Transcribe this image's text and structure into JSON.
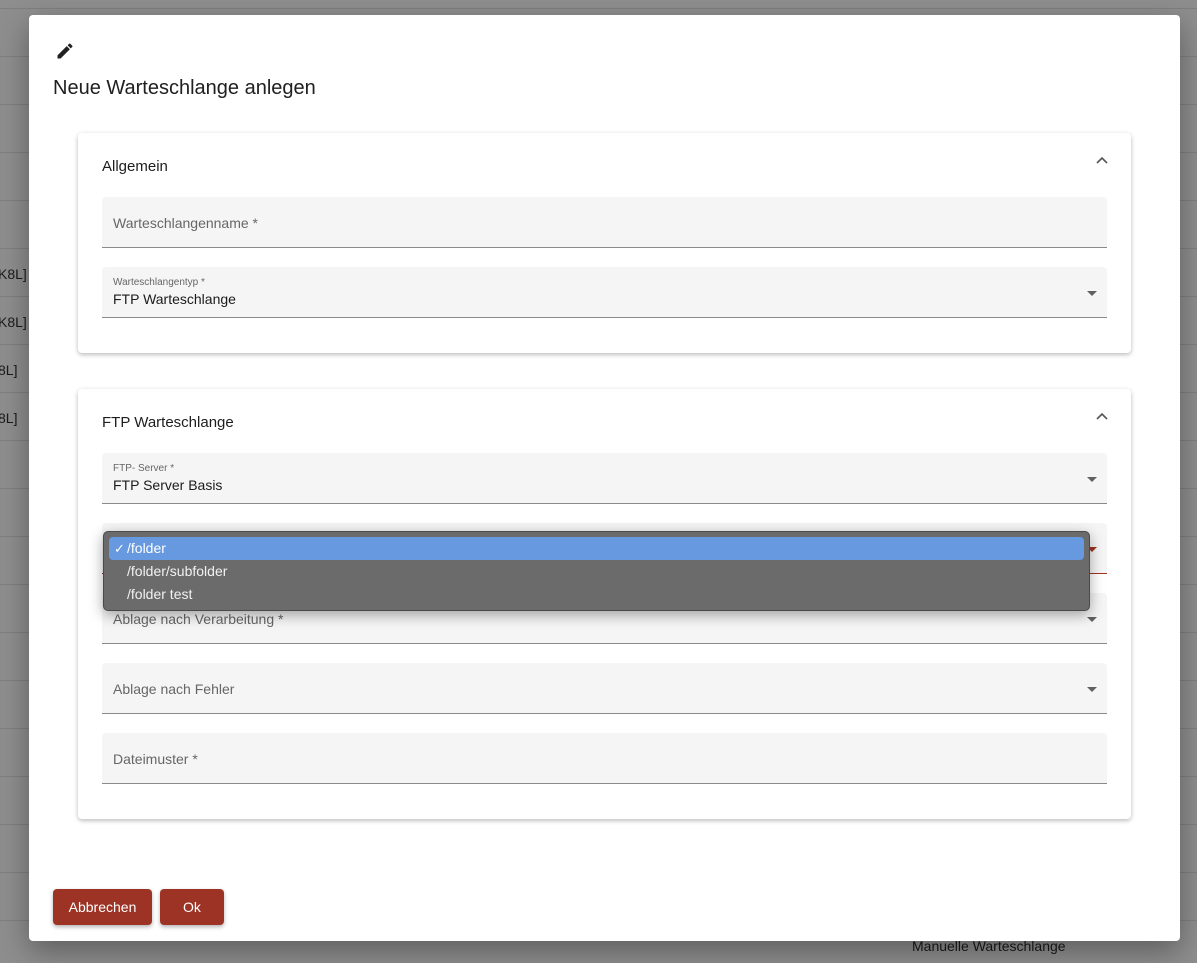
{
  "background": {
    "row_texts": [
      "K8L]",
      "K8L]",
      "8L]",
      "8L]"
    ],
    "footer_text": "Manuelle Warteschlange"
  },
  "dialog": {
    "title": "Neue Warteschlange anlegen",
    "icon": "pencil-icon"
  },
  "general_panel": {
    "title": "Allgemein",
    "queue_name": {
      "placeholder": "Warteschlangenname *",
      "value": ""
    },
    "queue_type": {
      "label": "Warteschlangentyp *",
      "value": "FTP Warteschlange"
    }
  },
  "ftp_panel": {
    "title": "FTP Warteschlange",
    "ftp_server": {
      "label": "FTP- Server *",
      "value": "FTP Server Basis"
    },
    "folder_select": {
      "options": [
        "/folder",
        "/folder/subfolder",
        "/folder test"
      ],
      "selected": "/folder"
    },
    "after_processing": {
      "placeholder": "Ablage nach Verarbeitung *"
    },
    "after_error": {
      "placeholder": "Ablage nach Fehler"
    },
    "file_pattern": {
      "placeholder": "Dateimuster *"
    }
  },
  "buttons": {
    "cancel": "Abbrechen",
    "ok": "Ok"
  },
  "colors": {
    "accent": "#9c3324",
    "dropdown_highlight": "#6699e0"
  }
}
